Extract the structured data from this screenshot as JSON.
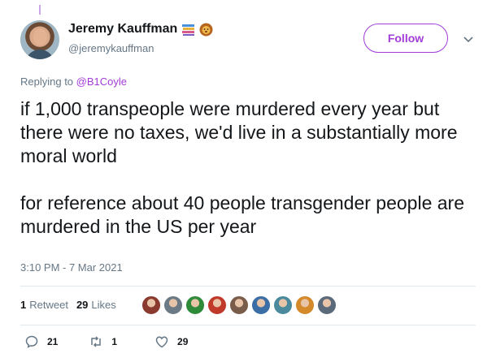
{
  "author": {
    "display_name": "Jeremy Kauffman",
    "handle": "@jeremykauffman",
    "badge_icons": [
      "books-emoji-icon",
      "lion-emoji-icon"
    ]
  },
  "follow_label": "Follow",
  "reply_context": {
    "prefix": "Replying to ",
    "mention": "@B1Coyle"
  },
  "body": "if 1,000 transpeople were murdered every year but there were no taxes, we'd live in a substantially more moral world\n\nfor reference about 40 people transgender people are murdered in the US per year",
  "timestamp": "3:10 PM - 7 Mar 2021",
  "stats": {
    "retweets_count": "1",
    "retweets_label": "Retweet",
    "likes_count": "29",
    "likes_label": "Likes"
  },
  "liker_avatar_colors": [
    "#8a3a2e",
    "#6c7a86",
    "#2f8a3a",
    "#c0392b",
    "#7a5c4a",
    "#3a6ea5",
    "#4a8a9c",
    "#d48a2a",
    "#5a6a7a"
  ],
  "actions": {
    "reply_count": "21",
    "retweet_count": "1",
    "like_count": "29"
  },
  "colors": {
    "accent": "#a23cd8",
    "secondary_text": "#657786",
    "divider": "#e1e8ed"
  }
}
